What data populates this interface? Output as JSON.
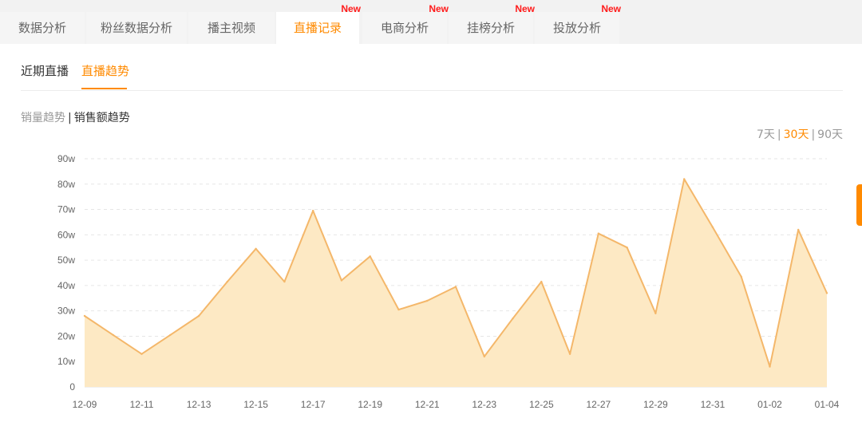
{
  "tabs": [
    {
      "label": "数据分析",
      "new": false,
      "active": false
    },
    {
      "label": "粉丝数据分析",
      "new": false,
      "active": false
    },
    {
      "label": "播主视频",
      "new": false,
      "active": false
    },
    {
      "label": "直播记录",
      "new": true,
      "active": true
    },
    {
      "label": "电商分析",
      "new": true,
      "active": false
    },
    {
      "label": "挂榜分析",
      "new": true,
      "active": false
    },
    {
      "label": "投放分析",
      "new": true,
      "active": false
    }
  ],
  "new_badge": "New",
  "subtabs": [
    {
      "label": "近期直播",
      "active": false
    },
    {
      "label": "直播趋势",
      "active": true
    }
  ],
  "metric_toggle": {
    "options": [
      "销量趋势",
      "销售额趋势"
    ],
    "separator": "|",
    "selected": "销售额趋势"
  },
  "range_toggle": {
    "options": [
      "7天",
      "30天",
      "90天"
    ],
    "separator": "|",
    "selected": "30天"
  },
  "colors": {
    "accent": "#ff8a00",
    "new_badge": "#ff1a1a",
    "line": "#f4b76a",
    "area": "#fde9c4"
  },
  "chart_data": {
    "type": "area",
    "x_tick_labels": [
      "12-09",
      "12-11",
      "12-13",
      "12-15",
      "12-17",
      "12-19",
      "12-21",
      "12-23",
      "12-25",
      "12-27",
      "12-29",
      "12-31",
      "01-02",
      "01-04"
    ],
    "y_tick_labels": [
      "0",
      "10w",
      "20w",
      "30w",
      "40w",
      "50w",
      "60w",
      "70w",
      "80w",
      "90w"
    ],
    "ylim": [
      0,
      90
    ],
    "y_unit": "w",
    "grid": true,
    "x": [
      "12-09",
      "12-10",
      "12-11",
      "12-12",
      "12-13",
      "12-14",
      "12-15",
      "12-16",
      "12-17",
      "12-18",
      "12-19",
      "12-20",
      "12-21",
      "12-22",
      "12-23",
      "12-24",
      "12-25",
      "12-26",
      "12-27",
      "12-28",
      "12-29",
      "12-30",
      "12-31",
      "01-01",
      "01-02",
      "01-03",
      "01-04"
    ],
    "values": [
      28,
      20.5,
      13,
      20.5,
      28,
      41.5,
      54.5,
      41.5,
      69.5,
      42,
      51.5,
      30.5,
      34,
      39.5,
      12,
      27,
      41.5,
      13,
      60.5,
      55,
      29,
      82,
      63,
      43.5,
      8,
      62,
      37
    ]
  }
}
